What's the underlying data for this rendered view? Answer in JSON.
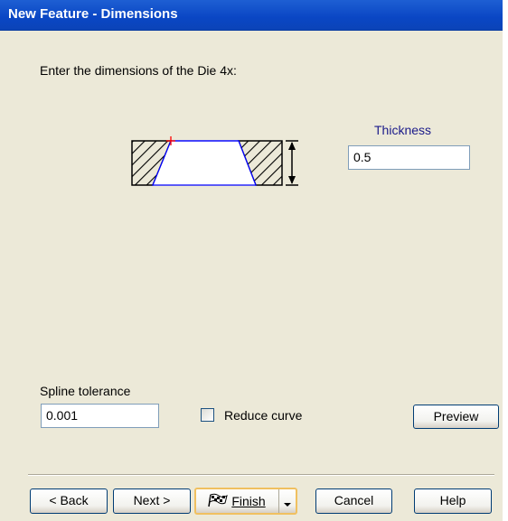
{
  "window": {
    "title": "New Feature - Dimensions"
  },
  "prompt": "Enter the dimensions of the Die 4x:",
  "thickness": {
    "label": "Thickness",
    "value": "0.5"
  },
  "spline": {
    "label": "Spline tolerance",
    "value": "0.001"
  },
  "reduce_curve": {
    "label": "Reduce curve",
    "checked": false
  },
  "buttons": {
    "preview": "Preview",
    "back": "< Back",
    "next": "Next >",
    "finish": "Finish",
    "cancel": "Cancel",
    "help": "Help"
  },
  "icons": {
    "finish": "checkered-flag-icon",
    "dropdown": "chevron-down-icon"
  },
  "colors": {
    "titlebar": "#0a46c4",
    "dialog_bg": "#ece9d8",
    "diagram_edge": "#0000ff",
    "marker": "#ff0000"
  }
}
